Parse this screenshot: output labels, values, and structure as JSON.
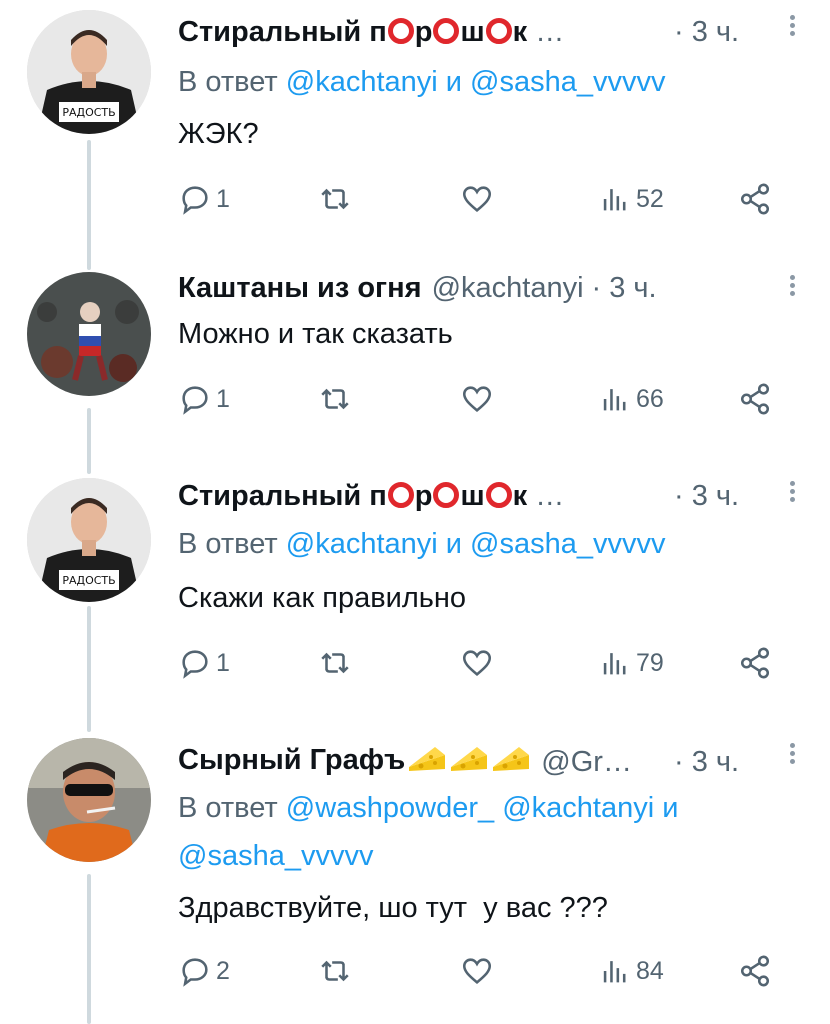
{
  "tweets": [
    {
      "name_parts": [
        "Стиральный п",
        "р",
        "ш",
        "к",
        " …"
      ],
      "handle": "",
      "time": "· 3 ч.",
      "reply_prefix": "В ответ",
      "mentions": [
        "@kachtanyi",
        "и",
        "@sasha_vvvvv"
      ],
      "text": "ЖЭК?",
      "replies": "1",
      "views": "52",
      "avatar": "man-radost-shirt"
    },
    {
      "name": "Каштаны из огня",
      "handle": "@kachtanyi",
      "time": "· 3 ч.",
      "text": "Можно и так сказать",
      "replies": "1",
      "views": "66",
      "avatar": "robot-figure-art"
    },
    {
      "name_parts": [
        "Стиральный п",
        "р",
        "ш",
        "к",
        " …"
      ],
      "handle": "",
      "time": "· 3 ч.",
      "reply_prefix": "В ответ",
      "mentions": [
        "@kachtanyi",
        "и",
        "@sasha_vvvvv"
      ],
      "text": "Скажи как правильно",
      "replies": "1",
      "views": "79",
      "avatar": "man-radost-shirt"
    },
    {
      "name": "Сырный Графъ",
      "handle": "@Gr…",
      "time": "· 3 ч.",
      "reply_prefix": "В ответ",
      "mentions_line1": [
        "@washpowder_",
        "@kachtanyi",
        "и"
      ],
      "mentions_line2": "@sasha_vvvvv",
      "text": "Здравствуйте, шо тут  у вас ???",
      "replies": "2",
      "views": "84",
      "avatar": "man-sunglasses-cigarette"
    }
  ],
  "icons": {
    "reply": "reply-icon",
    "retweet": "retweet-icon",
    "like": "heart-icon",
    "views": "views-icon",
    "share": "share-icon",
    "more": "more-options-icon"
  },
  "colors": {
    "link": "#1d9bf0",
    "secondary": "#536471",
    "thread_line": "#cfd9de",
    "emoji_circle": "#e0272c"
  }
}
